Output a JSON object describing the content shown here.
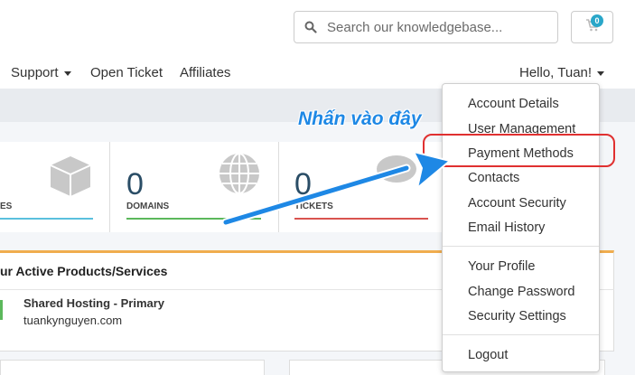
{
  "search": {
    "placeholder": "Search our knowledgebase..."
  },
  "cart": {
    "count": "0"
  },
  "nav": {
    "support": "Support",
    "open_ticket": "Open Ticket",
    "affiliates": "Affiliates",
    "greeting": "Hello, Tuan!"
  },
  "stats": [
    {
      "value": "",
      "label": "ES",
      "color": "#5bc0de"
    },
    {
      "value": "0",
      "label": "DOMAINS",
      "color": "#5cb85c"
    },
    {
      "value": "0",
      "label": "TICKETS",
      "color": "#d9534f"
    }
  ],
  "products": {
    "title": "ur Active Products/Services",
    "service_name": "Shared Hosting - Primary",
    "service_domain": "tuankynguyen.com"
  },
  "dropdown": {
    "group1": [
      "Account Details",
      "User Management",
      "Payment Methods",
      "Contacts",
      "Account Security",
      "Email History"
    ],
    "group2": [
      "Your Profile",
      "Change Password",
      "Security Settings"
    ],
    "group3": [
      "Logout"
    ]
  },
  "annotation": {
    "text": "Nhấn vào đây",
    "color": "#1e88e5",
    "highlight_color": "#e03030"
  }
}
